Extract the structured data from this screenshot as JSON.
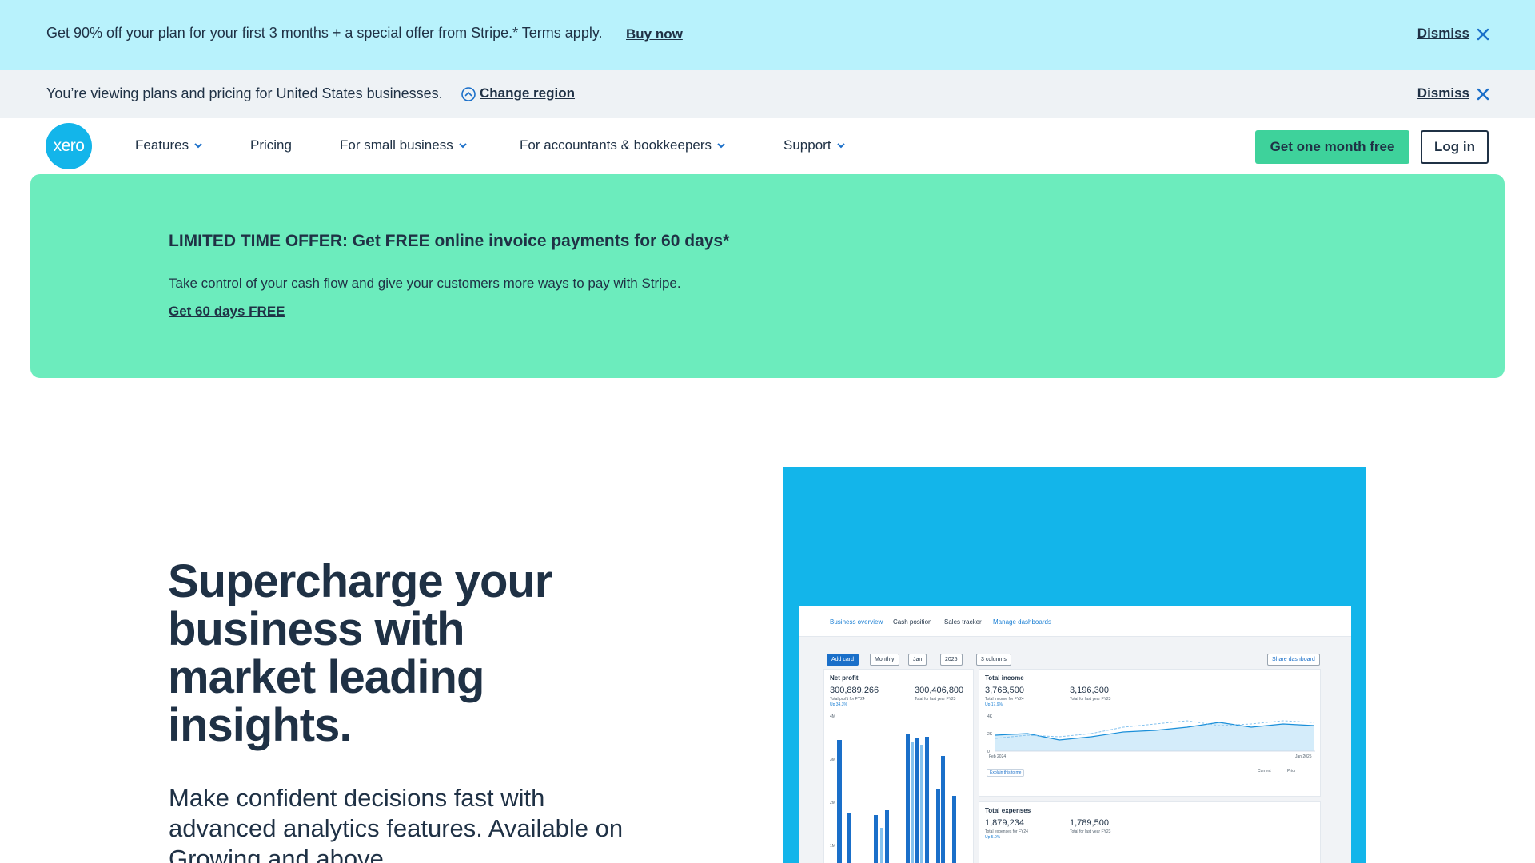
{
  "promo_banner": {
    "text": "Get 90% off your plan for your first 3 months + a special offer from Stripe.* Terms apply.",
    "link": "Buy now",
    "dismiss": "Dismiss"
  },
  "region_banner": {
    "text": "You’re viewing plans and pricing for United States businesses.",
    "link": "Change region",
    "dismiss": "Dismiss"
  },
  "nav": {
    "logo": "xero",
    "items": [
      {
        "label": "Features",
        "dropdown": true
      },
      {
        "label": "Pricing",
        "dropdown": false
      },
      {
        "label": "For small business",
        "dropdown": true
      },
      {
        "label": "For accountants & bookkeepers",
        "dropdown": true
      },
      {
        "label": "Support",
        "dropdown": true
      }
    ],
    "cta": "Get one month free",
    "login": "Log in"
  },
  "offer": {
    "title": "LIMITED TIME OFFER: Get FREE online invoice payments for 60 days*",
    "text": "Take control of your cash flow and give your customers more ways to pay with Stripe.",
    "link": "Get 60 days FREE"
  },
  "hero": {
    "title": "Supercharge your business with market leading insights.",
    "subtitle": "Make confident decisions fast with advanced analytics features. Available on Growing and above."
  },
  "dashboard": {
    "tabs": [
      "Business overview",
      "Cash position",
      "Sales tracker",
      "Manage dashboards"
    ],
    "toolbar": [
      "Add card",
      "Monthly",
      "Jan",
      "2025",
      "3 columns"
    ],
    "share": "Share dashboard",
    "net_profit": {
      "title": "Net profit",
      "value": "300,889,266",
      "caption": "Total profit for FY24",
      "change": "Up 34.3%",
      "compare_value": "300,406,800",
      "compare_caption": "Total for last year FY23",
      "y_ticks": [
        "4M",
        "3M",
        "2M",
        "1M"
      ]
    },
    "total_income": {
      "title": "Total income",
      "value": "3,768,500",
      "caption": "Total income for FY24",
      "change": "Up 17.9%",
      "compare_value": "3,196,300",
      "compare_caption": "Total for last year FY23",
      "y_ticks": [
        "4K",
        "2K",
        "0"
      ],
      "x_start": "Feb 2024",
      "x_end": "Jan 2025",
      "explain": "Explain this to me",
      "legend_current": "Current",
      "legend_prior": "Prior"
    },
    "total_expenses": {
      "title": "Total expenses",
      "value": "1,879,234",
      "caption": "Total expenses for FY24",
      "change": "Up 5.0%",
      "compare_value": "1,789,500",
      "compare_caption": "Total for last year FY23"
    }
  },
  "colors": {
    "promo_bg": "#b8f2fc",
    "region_bg": "#eef2f5",
    "offer_bg": "#6cecbd",
    "cta_bg": "#3ed29b",
    "brand_blue": "#13b5ea",
    "text": "#1f3145"
  }
}
